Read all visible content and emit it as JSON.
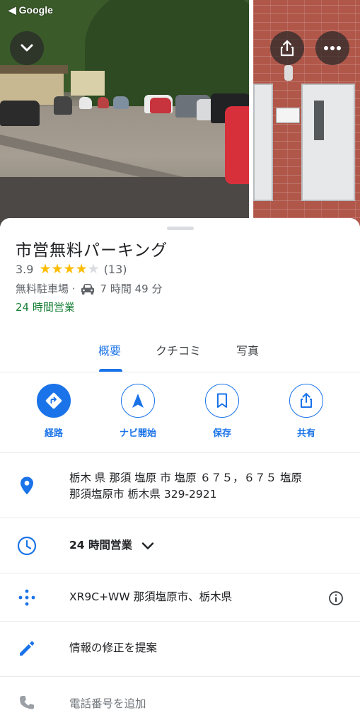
{
  "status_bar": {
    "back_label": "◀ Google"
  },
  "place": {
    "name": "市営無料パーキング",
    "rating": "3.9",
    "stars": [
      1,
      1,
      1,
      1,
      0
    ],
    "review_count": "(13)",
    "category": "無料駐車場 ·",
    "drive_time": "7 時間 49 分",
    "hours_status": "24 時間営業"
  },
  "tabs": [
    {
      "label": "概要",
      "active": true
    },
    {
      "label": "クチコミ",
      "active": false
    },
    {
      "label": "写真",
      "active": false
    }
  ],
  "actions": [
    {
      "label": "経路",
      "icon": "directions-icon"
    },
    {
      "label": "ナビ開始",
      "icon": "navigation-arrow-icon"
    },
    {
      "label": "保存",
      "icon": "bookmark-icon"
    },
    {
      "label": "共有",
      "icon": "share-icon"
    }
  ],
  "details": {
    "address_line1": "栃木 県 那須 塩原 市 塩原 ６７５，６７５ 塩原",
    "address_line2": "那須塩原市 栃木県 329-2921",
    "hours": "24 時間営業",
    "plus_code": "XR9C+WW 那須塩原市、栃木県",
    "suggest_edit": "情報の修正を提案",
    "add_phone": "電話番号を追加"
  },
  "colors": {
    "accent": "#1a73e8",
    "star": "#fbbc04",
    "star_empty": "#dadce0",
    "open_green": "#188038"
  }
}
